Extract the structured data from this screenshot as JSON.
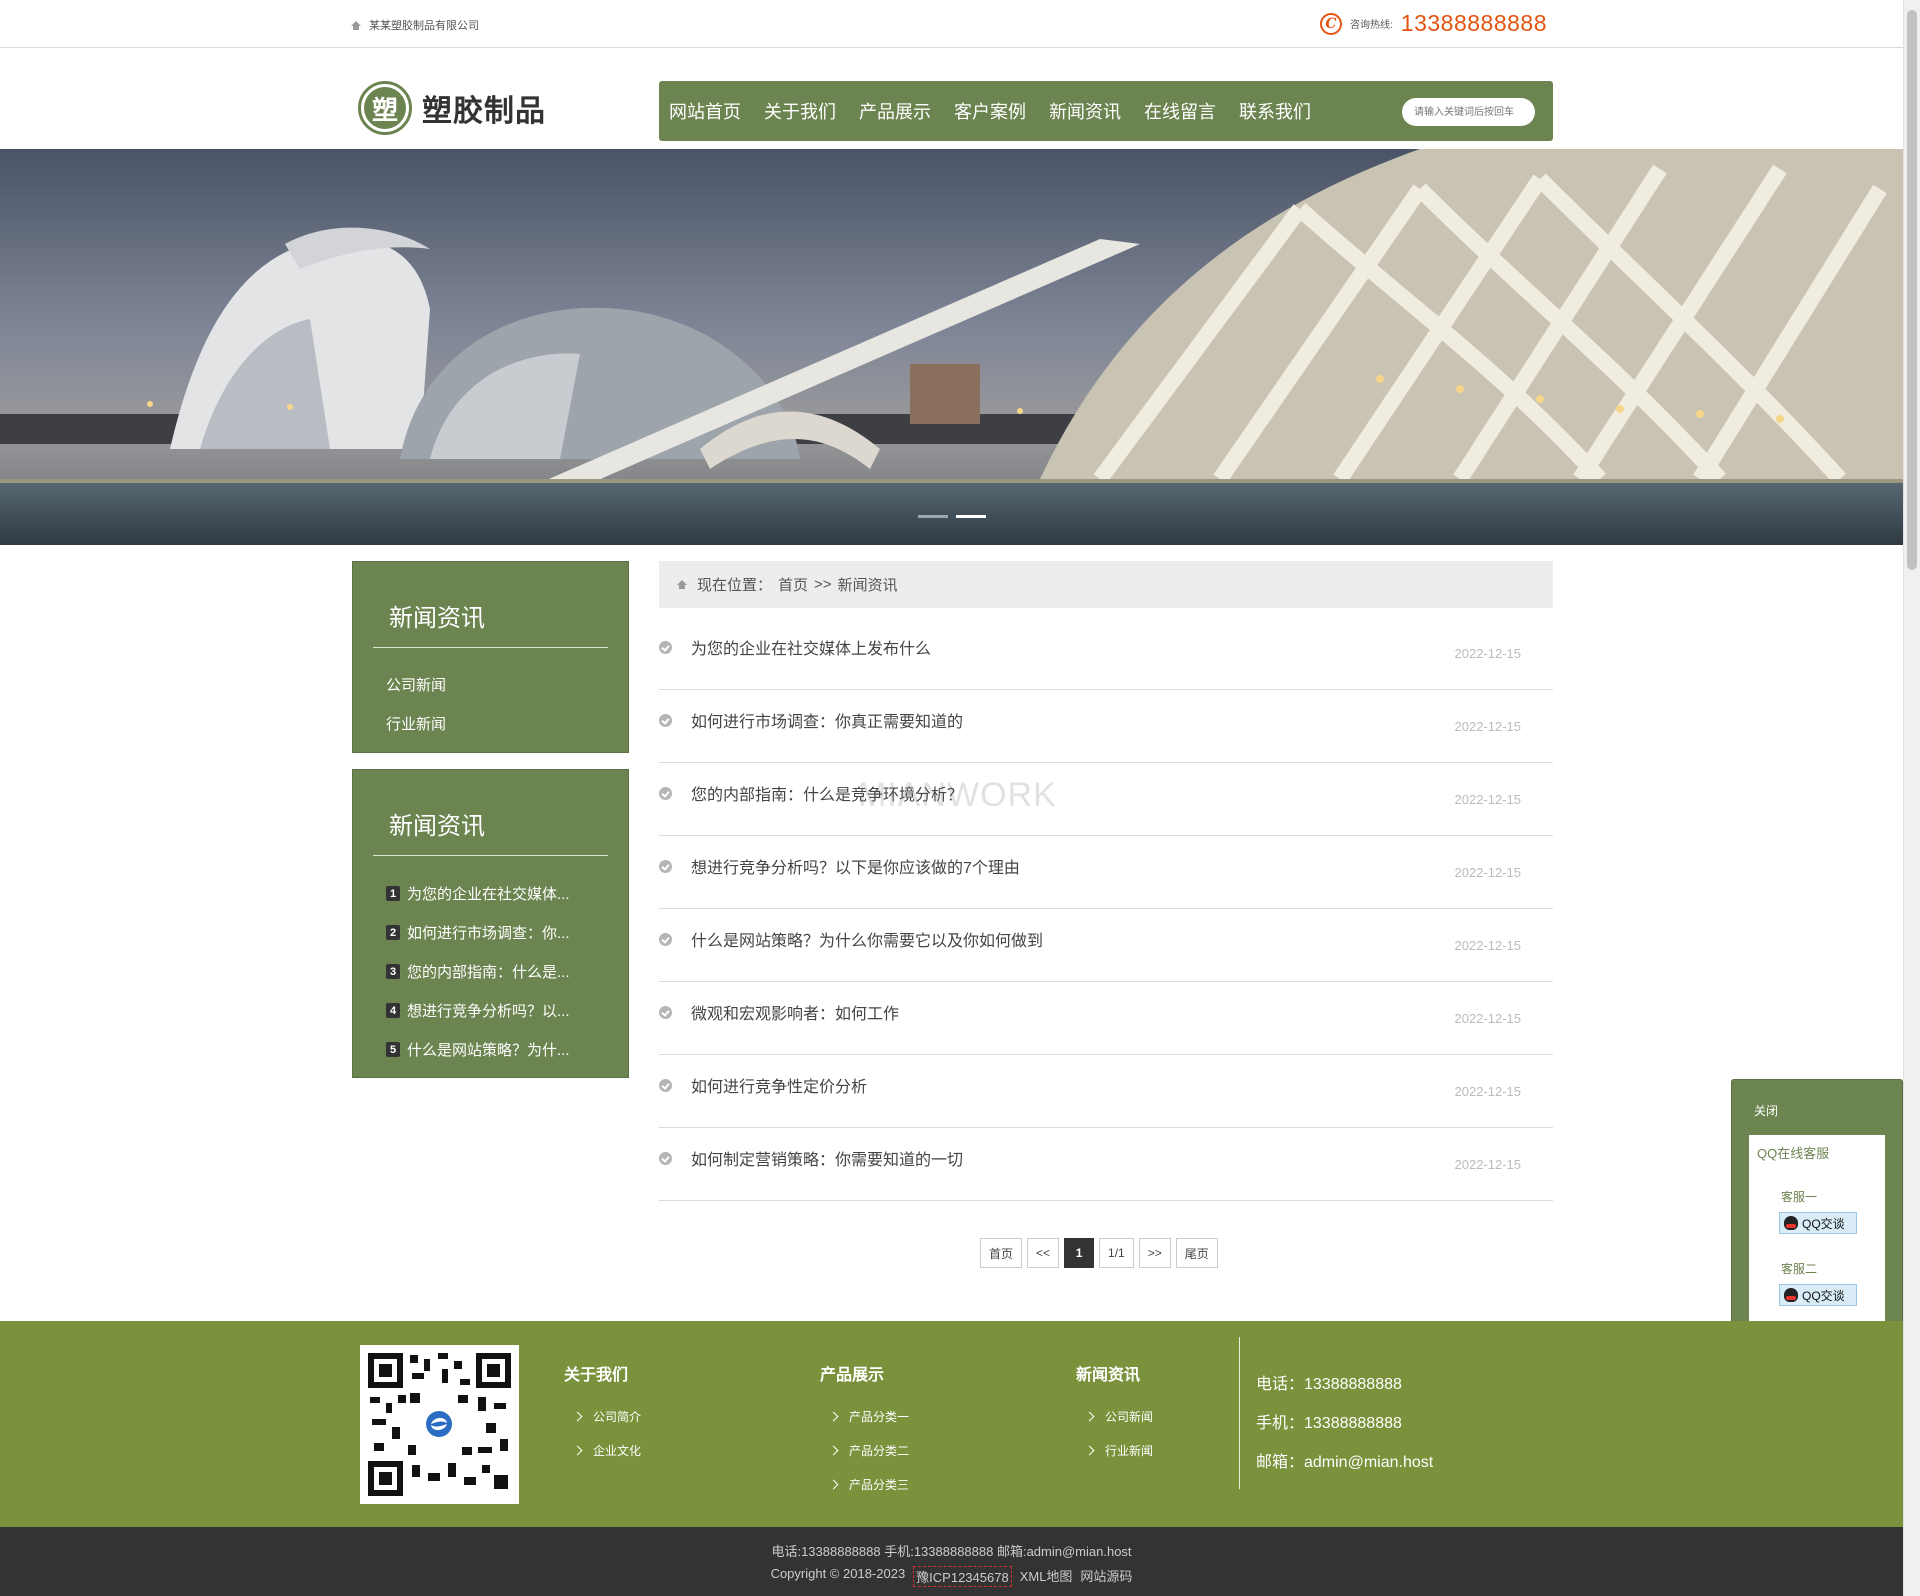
{
  "topbar": {
    "company_name": "某某塑胶制品有限公司",
    "hotline_label": "咨询热线:",
    "hotline_number": "13388888888"
  },
  "header": {
    "logo_char": "塑",
    "logo_text": "塑胶制品",
    "nav": [
      "网站首页",
      "关于我们",
      "产品展示",
      "客户案例",
      "新闻资讯",
      "在线留言",
      "联系我们"
    ],
    "search_placeholder": "请输入关键词后按回车"
  },
  "banner": {
    "slides_total": 2,
    "active_slide": 2
  },
  "sidebar": {
    "category_title": "新闻资讯",
    "categories": [
      "公司新闻",
      "行业新闻"
    ],
    "ranking_title": "新闻资讯",
    "ranking": [
      {
        "num": "1",
        "title": "为您的企业在社交媒体..."
      },
      {
        "num": "2",
        "title": "如何进行市场调查：你..."
      },
      {
        "num": "3",
        "title": "您的内部指南：什么是..."
      },
      {
        "num": "4",
        "title": "想进行竞争分析吗？以..."
      },
      {
        "num": "5",
        "title": "什么是网站策略？为什..."
      }
    ]
  },
  "breadcrumb": {
    "label": "现在位置：",
    "home": "首页",
    "separator": ">>",
    "current": "新闻资讯"
  },
  "news": [
    {
      "title": "为您的企业在社交媒体上发布什么",
      "date": "2022-12-15"
    },
    {
      "title": "如何进行市场调查：你真正需要知道的",
      "date": "2022-12-15"
    },
    {
      "title": "您的内部指南：什么是竞争环境分析？",
      "date": "2022-12-15"
    },
    {
      "title": "想进行竞争分析吗？以下是你应该做的7个理由",
      "date": "2022-12-15"
    },
    {
      "title": "什么是网站策略？为什么你需要它以及你如何做到",
      "date": "2022-12-15"
    },
    {
      "title": "微观和宏观影响者：如何工作",
      "date": "2022-12-15"
    },
    {
      "title": "如何进行竞争性定价分析",
      "date": "2022-12-15"
    },
    {
      "title": "如何制定营销策略：你需要知道的一切",
      "date": "2022-12-15"
    }
  ],
  "watermark": "MIANWORK",
  "pager": {
    "first": "首页",
    "prev": "<<",
    "current": "1",
    "info": "1/1",
    "next": ">>",
    "last": "尾页"
  },
  "qq_panel": {
    "close": "关闭",
    "title": "QQ在线客服",
    "agents": [
      {
        "name": "客服一",
        "button": "QQ交谈"
      },
      {
        "name": "客服二",
        "button": "QQ交谈"
      }
    ]
  },
  "footer": {
    "columns": [
      {
        "title": "关于我们",
        "links": [
          "公司简介",
          "企业文化"
        ]
      },
      {
        "title": "产品展示",
        "links": [
          "产品分类一",
          "产品分类二",
          "产品分类三"
        ]
      },
      {
        "title": "新闻资讯",
        "links": [
          "公司新闻",
          "行业新闻"
        ]
      }
    ],
    "contact": {
      "phone": "电话：13388888888",
      "mobile": "手机：13388888888",
      "email": "邮箱：admin@mian.host"
    },
    "bottom_line1": "电话:13388888888  手机:13388888888  邮箱:admin@mian.host",
    "copyright": "Copyright © 2018-2023",
    "icp": "豫ICP12345678",
    "sitemap": "XML地图",
    "source": "网站源码"
  },
  "colors": {
    "brand_green": "#6c8450",
    "footer_green": "#7a923b",
    "hotline_orange": "#e2540f",
    "bottom_bar": "#333333"
  }
}
